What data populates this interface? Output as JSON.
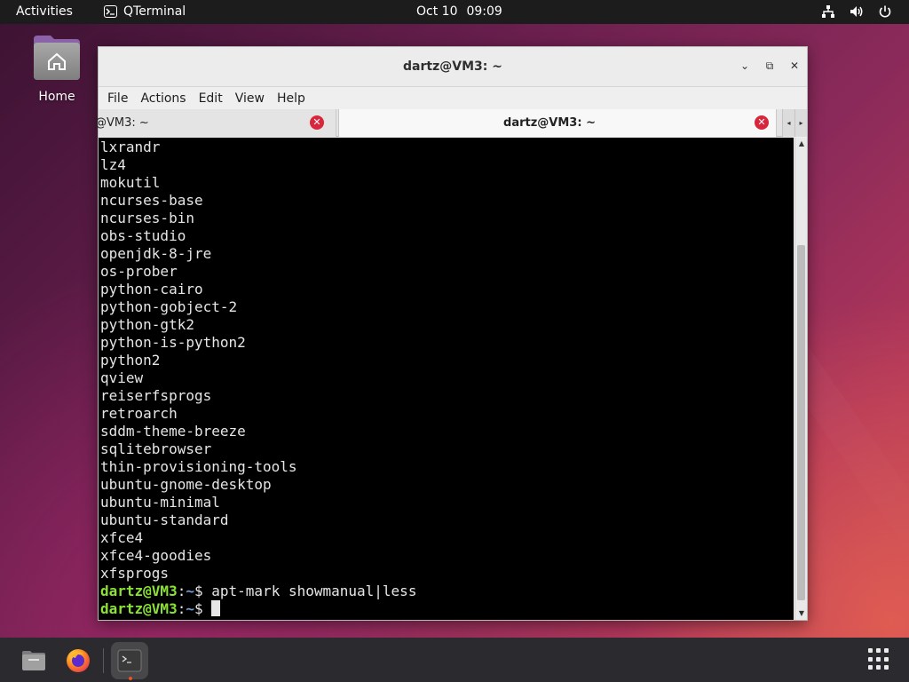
{
  "topbar": {
    "activities": "Activities",
    "app_name": "QTerminal",
    "app_icon_glyph": "⌨",
    "date": "Oct 10",
    "time": "09:09",
    "tray_icons": [
      "network-icon",
      "volume-icon",
      "power-icon"
    ]
  },
  "desktop": {
    "home_label": "Home"
  },
  "window": {
    "title": "dartz@VM3: ~",
    "controls": [
      "minimize",
      "maximize",
      "close"
    ],
    "control_glyphs": {
      "minimize": "⌄",
      "maximize": "⧉",
      "close": "✕"
    },
    "menu": [
      "File",
      "Actions",
      "Edit",
      "View",
      "Help"
    ],
    "tabs": [
      {
        "label": "@VM3: ~",
        "active": false
      },
      {
        "label": "dartz@VM3: ~",
        "active": true
      }
    ],
    "tab_close_glyph": "✕",
    "tab_scroll_left": "◂",
    "tab_scroll_right": "▸"
  },
  "terminal": {
    "output_lines": [
      "lxrandr",
      "lz4",
      "mokutil",
      "ncurses-base",
      "ncurses-bin",
      "obs-studio",
      "openjdk-8-jre",
      "os-prober",
      "python-cairo",
      "python-gobject-2",
      "python-gtk2",
      "python-is-python2",
      "python2",
      "qview",
      "reiserfsprogs",
      "retroarch",
      "sddm-theme-breeze",
      "sqlitebrowser",
      "thin-provisioning-tools",
      "ubuntu-gnome-desktop",
      "ubuntu-minimal",
      "ubuntu-standard",
      "xfce4",
      "xfce4-goodies",
      "xfsprogs"
    ],
    "prompts": [
      {
        "user": "dartz@VM3",
        "sep": ":",
        "path": "~",
        "symbol": "$",
        "command": " apt-mark showmanual|less"
      },
      {
        "user": "dartz@VM3",
        "sep": ":",
        "path": "~",
        "symbol": "$",
        "command": " "
      }
    ],
    "scroll_position_fraction": 0.93
  },
  "dock": {
    "items": [
      {
        "name": "files-app",
        "active": false
      },
      {
        "name": "firefox-app",
        "active": false
      },
      {
        "name": "terminal-app",
        "active": true
      }
    ]
  },
  "colors": {
    "prompt_user": "#8ae234",
    "prompt_path": "#729fcf",
    "tab_close": "#d8263c",
    "topbar": "#1c1c1c",
    "dock": "#2b2a2e"
  }
}
